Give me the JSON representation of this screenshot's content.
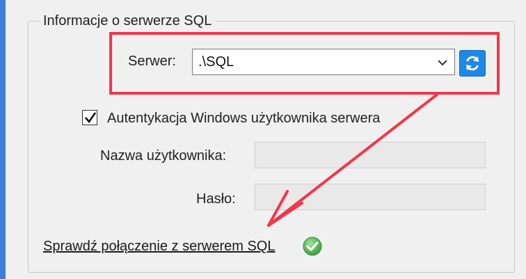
{
  "group": {
    "title": "Informacje o serwerze SQL"
  },
  "server": {
    "label": "Serwer:",
    "value": ".\\SQL",
    "dropdown_icon": "chevron-down-icon",
    "refresh_icon": "refresh-icon"
  },
  "auth": {
    "checkbox_label": "Autentykacja Windows użytkownika serwera",
    "checked": true
  },
  "username": {
    "label": "Nazwa użytkownika:",
    "value": ""
  },
  "password": {
    "label": "Hasło:",
    "value": ""
  },
  "test_link": {
    "label": "Sprawdź połączenie z serwerem SQL",
    "status_icon": "check-circle-icon"
  },
  "colors": {
    "accent_blue": "#1e88e5",
    "annotation_red": "#f2364a",
    "success_green": "#5cb85c"
  }
}
